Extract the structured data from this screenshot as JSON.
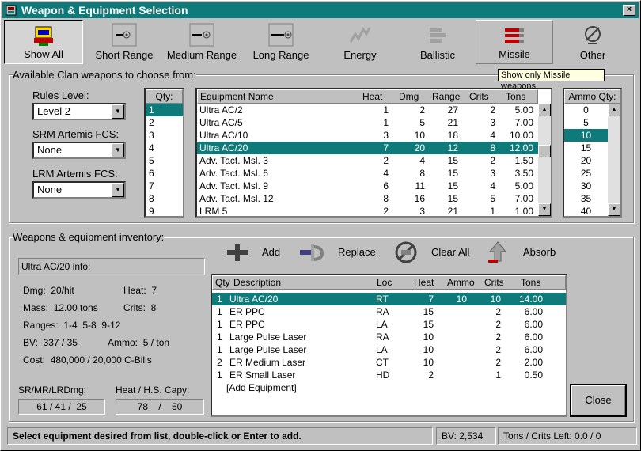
{
  "window": {
    "title": "Weapon & Equipment Selection",
    "close_glyph": "×"
  },
  "toolbar": [
    {
      "label": "Show All",
      "icon": "show-all-icon"
    },
    {
      "label": "Short Range",
      "icon": "short-range-icon"
    },
    {
      "label": "Medium Range",
      "icon": "medium-range-icon"
    },
    {
      "label": "Long Range",
      "icon": "long-range-icon"
    },
    {
      "label": "Energy",
      "icon": "energy-icon"
    },
    {
      "label": "Ballistic",
      "icon": "ballistic-icon"
    },
    {
      "label": "Missile",
      "icon": "missile-icon"
    },
    {
      "label": "Other",
      "icon": "other-icon"
    }
  ],
  "tooltip": "Show only Missile weapons",
  "available": {
    "group_label": "Available Clan weapons to choose from:",
    "rules_level_label": "Rules Level:",
    "rules_level_value": "Level 2",
    "srm_label": "SRM Artemis FCS:",
    "srm_value": "None",
    "lrm_label": "LRM Artemis FCS:",
    "lrm_value": "None",
    "qty_header": "Qty:",
    "qty_items": [
      "1",
      "2",
      "3",
      "4",
      "5",
      "6",
      "7",
      "8",
      "9"
    ],
    "qty_selected": 0,
    "equip_headers": {
      "name": "Equipment Name",
      "heat": "Heat",
      "dmg": "Dmg",
      "range": "Range",
      "crits": "Crits",
      "tons": "Tons"
    },
    "equipment": [
      {
        "name": "Ultra AC/2",
        "heat": "1",
        "dmg": "2",
        "range": "27",
        "crits": "2",
        "tons": "5.00"
      },
      {
        "name": "Ultra AC/5",
        "heat": "1",
        "dmg": "5",
        "range": "21",
        "crits": "3",
        "tons": "7.00"
      },
      {
        "name": "Ultra AC/10",
        "heat": "3",
        "dmg": "10",
        "range": "18",
        "crits": "4",
        "tons": "10.00"
      },
      {
        "name": "Ultra AC/20",
        "heat": "7",
        "dmg": "20",
        "range": "12",
        "crits": "8",
        "tons": "12.00"
      },
      {
        "name": "Adv. Tact. Msl. 3",
        "heat": "2",
        "dmg": "4",
        "range": "15",
        "crits": "2",
        "tons": "1.50"
      },
      {
        "name": "Adv. Tact. Msl. 6",
        "heat": "4",
        "dmg": "8",
        "range": "15",
        "crits": "3",
        "tons": "3.50"
      },
      {
        "name": "Adv. Tact. Msl. 9",
        "heat": "6",
        "dmg": "11",
        "range": "15",
        "crits": "4",
        "tons": "5.00"
      },
      {
        "name": "Adv. Tact. Msl. 12",
        "heat": "8",
        "dmg": "16",
        "range": "15",
        "crits": "5",
        "tons": "7.00"
      },
      {
        "name": "LRM 5",
        "heat": "2",
        "dmg": "3",
        "range": "21",
        "crits": "1",
        "tons": "1.00"
      }
    ],
    "equipment_selected": 3,
    "ammo_header": "Ammo Qty:",
    "ammo_items": [
      "0",
      "5",
      "10",
      "15",
      "20",
      "25",
      "30",
      "35",
      "40"
    ],
    "ammo_selected": 2
  },
  "inventory": {
    "group_label": "Weapons & equipment inventory:",
    "info_title": "Ultra AC/20 info:",
    "dmg_label": "Dmg:",
    "dmg_value": "20/hit",
    "heat_label": "Heat:",
    "heat_value": "7",
    "mass_label": "Mass:",
    "mass_value": "12.00 tons",
    "crits_label": "Crits:",
    "crits_value": "8",
    "ranges_label": "Ranges:",
    "ranges_value": "1-4  5-8  9-12",
    "bv_label": "BV:",
    "bv_value": "337 / 35",
    "ammo_label": "Ammo:",
    "ammo_value": "5 / ton",
    "cost_label": "Cost:",
    "cost_value": "480,000 / 20,000 C-Bills",
    "srmrlrd_label": "SR/MR/LRDmg:",
    "srmrlrd_value": "61 / 41 /  25",
    "heat_capy_label": "Heat / H.S. Capy:",
    "heat_capy_value": "78    /    50",
    "actions": {
      "add": "Add",
      "replace": "Replace",
      "clear_all": "Clear All",
      "absorb": "Absorb"
    },
    "headers": {
      "qty": "Qty",
      "desc": "Description",
      "loc": "Loc",
      "heat": "Heat",
      "ammo": "Ammo",
      "crits": "Crits",
      "tons": "Tons"
    },
    "rows": [
      {
        "qty": "1",
        "desc": "Ultra AC/20",
        "loc": "RT",
        "heat": "7",
        "ammo": "10",
        "crits": "10",
        "tons": "14.00"
      },
      {
        "qty": "1",
        "desc": "ER PPC",
        "loc": "RA",
        "heat": "15",
        "ammo": "",
        "crits": "2",
        "tons": "6.00"
      },
      {
        "qty": "1",
        "desc": "ER PPC",
        "loc": "LA",
        "heat": "15",
        "ammo": "",
        "crits": "2",
        "tons": "6.00"
      },
      {
        "qty": "1",
        "desc": "Large Pulse Laser",
        "loc": "RA",
        "heat": "10",
        "ammo": "",
        "crits": "2",
        "tons": "6.00"
      },
      {
        "qty": "1",
        "desc": "Large Pulse Laser",
        "loc": "LA",
        "heat": "10",
        "ammo": "",
        "crits": "2",
        "tons": "6.00"
      },
      {
        "qty": "2",
        "desc": "ER Medium Laser",
        "loc": "CT",
        "heat": "10",
        "ammo": "",
        "crits": "2",
        "tons": "2.00"
      },
      {
        "qty": "1",
        "desc": "ER Small Laser",
        "loc": "HD",
        "heat": "2",
        "ammo": "",
        "crits": "1",
        "tons": "0.50"
      }
    ],
    "add_row": "[Add Equipment]",
    "selected": 0,
    "close_label": "Close"
  },
  "status": {
    "message": "Select equipment desired from list, double-click or Enter to add.",
    "bv": "BV:  2,534",
    "tons_crits": "Tons / Crits Left: 0.0 / 0"
  }
}
